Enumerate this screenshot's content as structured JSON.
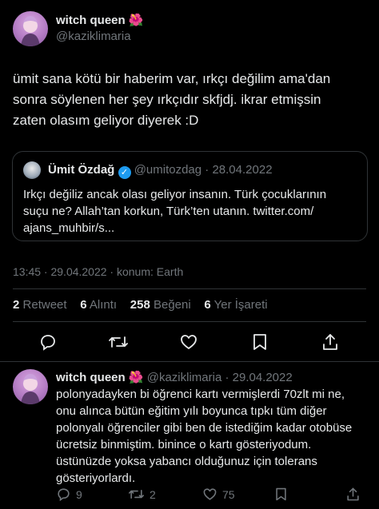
{
  "main_tweet": {
    "author_name": "witch queen",
    "author_emoji": "🌺",
    "author_handle": "@kaziklimaria",
    "text_line1": "ümit sana kötü bir haberim var, ırkçı değilim ama'dan",
    "text_line2": "sonra söylenen her şey ırkçıdır skfjdj. ikrar etmişsin",
    "text_line3": "zaten olasım geliyor diyerek :D",
    "timestamp": "13:45 · 29.04.2022 · konum: Earth"
  },
  "quoted_tweet": {
    "author_name": "Ümit Özdağ",
    "author_handle": "@umitozdag",
    "date": "· 28.04.2022",
    "text_line1": "Irkçı değiliz ancak olası geliyor insanın. Türk çocuklarının",
    "text_line2": "suçu ne? Allah’tan korkun, Türk’ten utanın. twitter.com/",
    "text_line3": "ajans_muhbir/s..."
  },
  "stats": {
    "retweets_count": "2",
    "retweets_label": "Retweet",
    "quotes_count": "6",
    "quotes_label": "Alıntı",
    "likes_count": "258",
    "likes_label": "Beğeni",
    "bookmarks_count": "6",
    "bookmarks_label": "Yer İşareti"
  },
  "reply_tweet": {
    "author_name": "witch queen",
    "author_emoji": "🌺",
    "author_handle": "@kaziklimaria",
    "date": "· 29.04.2022",
    "text_line1": "polonyadayken bi öğrenci kartı vermişlerdi 70zlt mi ne,",
    "text_line2": "onu alınca bütün eğitim yılı boyunca tıpkı tüm diğer",
    "text_line3": "polonyalı öğrenciler gibi ben de istediğim kadar otobüse",
    "text_line4": "ücretsiz binmiştim. binince o kartı gösteriyodum.",
    "text_line5": "üstünüzde yoksa yabancı olduğunuz için tolerans",
    "text_line6": "gösteriyorlardı.",
    "reply_count": "9",
    "retweet_count": "2",
    "like_count": "75"
  },
  "colors": {
    "background": "#000000",
    "text": "#e7e9ea",
    "muted": "#71767b",
    "border": "#2f3336",
    "verified": "#1d9bf0"
  }
}
